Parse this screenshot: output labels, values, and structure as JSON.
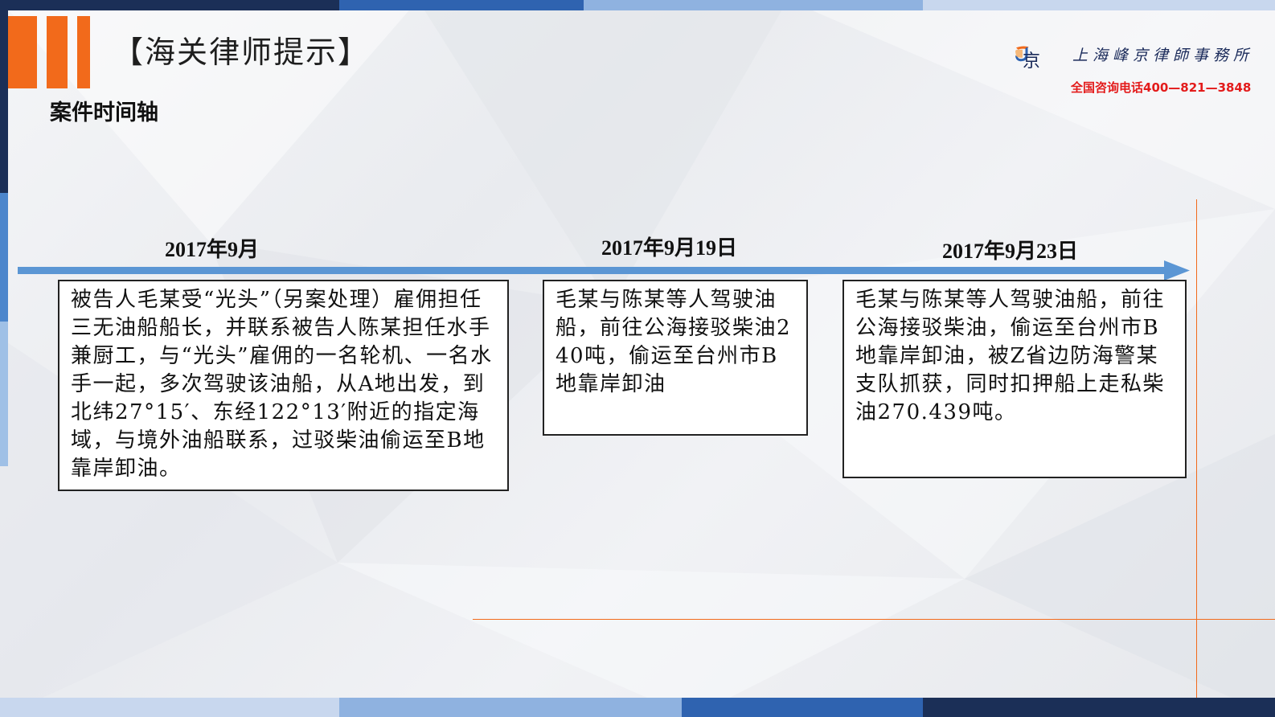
{
  "header": {
    "title": "【海关律师提示】",
    "subtitle": "案件时间轴"
  },
  "branding": {
    "firm_name": "上海峰京律師事務所",
    "hotline": "全国咨询电话400—821—3848",
    "logo_glyph": "京",
    "logo_icon": "firm-logo-icon",
    "accent_orange": "#f26a1b",
    "accent_blue": "#5b96d4",
    "dark_navy": "#1b2f57"
  },
  "timeline": {
    "events": [
      {
        "date": "2017年9月",
        "text": "被告人毛某受“光头”（另案处理）雇佣担任三无油船船长，并联系被告人陈某担任水手兼厨工，与“光头”雇佣的一名轮机、一名水手一起，多次驾驶该油船，从A地出发，到北纬27°15′、东经122°13′附近的指定海域，与境外油船联系，过驳柴油偷运至B地靠岸卸油。"
      },
      {
        "date": "2017年9月19日",
        "text": "毛某与陈某等人驾驶油船，前往公海接驳柴油240吨，偷运至台州市B地靠岸卸油"
      },
      {
        "date": "2017年9月23日",
        "text": "毛某与陈某等人驾驶油船，前往公海接驳柴油，偷运至台州市B地靠岸卸油，被Z省边防海警某支队抓获，同时扣押船上走私柴油270.439吨。"
      }
    ]
  }
}
